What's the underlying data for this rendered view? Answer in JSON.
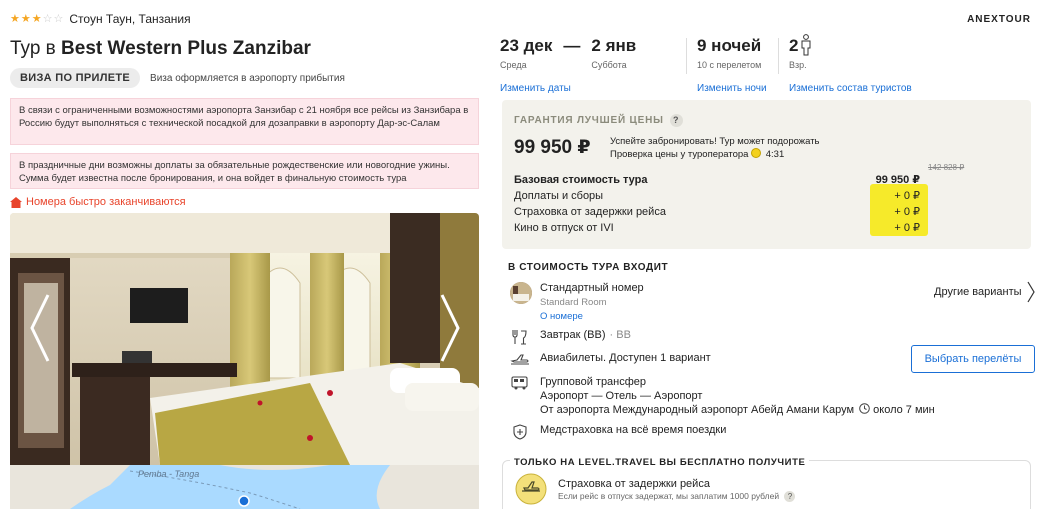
{
  "hotel": {
    "stars": 3,
    "max_stars": 5,
    "location": "Стоун Таун, Танзания",
    "title_prefix": "Тур в",
    "title_name": "Best Western Plus Zanzibar"
  },
  "visa": {
    "badge": "ВИЗА ПО ПРИЛЕТЕ",
    "note": "Виза оформляется в аэропорту прибытия"
  },
  "notices": [
    "В связи с ограниченными возможностями аэропорта Занзибар с 21 ноября все рейсы из Занзибара в Россию будут выполняться с технической посадкой для дозаправки в аэропорту Дар-эс-Салам",
    "В праздничные дни возможны доплаты за обязательные рождественские или новогодние ужины. Сумма будет известна после бронирования, и она войдет в финальную стоимость тура"
  ],
  "rooms_warning": "Номера быстро заканчиваются",
  "operator": "ANEXTOUR",
  "dates": {
    "from": "23 дек",
    "from_day": "Среда",
    "to": "2 янв",
    "to_day": "Суббота",
    "nights": "9 ночей",
    "nights_note": "10 с перелетом",
    "tourists": "2",
    "tourists_note": "Взр.",
    "change_dates": "Изменить даты",
    "change_nights": "Изменить ночи",
    "change_tourists": "Изменить состав туристов"
  },
  "price": {
    "guarantee": "ГАРАНТИЯ ЛУЧШЕЙ ЦЕНЫ",
    "question": "?",
    "main": "99 950 ₽",
    "hurry_line1": "Успейте забронировать! Тур может подорожать",
    "hurry_line2": "Проверка цены у туроператора",
    "timer": "4:31",
    "old_price": "142 828 ₽",
    "rows": [
      {
        "label": "Базовая стоимость тура",
        "value": "99 950 ₽"
      },
      {
        "label": "Доплаты и сборы",
        "value": "+ 0 ₽"
      },
      {
        "label": "Страховка от задержки рейса",
        "value": "+ 0 ₽"
      },
      {
        "label": "Кино в отпуск от IVI",
        "value": "+ 0 ₽"
      }
    ]
  },
  "includes": {
    "title": "В СТОИМОСТЬ ТУРА ВХОДИТ",
    "room": "Стандартный номер",
    "room_type": "Standard Room",
    "room_link": "О номере",
    "other_variants": "Другие варианты",
    "meal": "Завтрак (BB)",
    "meal_code": "· BB",
    "flights": "Авиабилеты. Доступен 1 вариант",
    "flight_button": "Выбрать перелёты",
    "transfer": "Групповой трансфер",
    "transfer_route": "Аэропорт — Отель — Аэропорт",
    "transfer_from": "От аэропорта Международный аэропорт Абейд Амани Карум",
    "transfer_time": "около 7 мин",
    "insurance": "Медстраховка на всё время поездки"
  },
  "free": {
    "title": "ТОЛЬКО НА LEVEL.TRAVEL ВЫ БЕСПЛАТНО ПОЛУЧИТЕ",
    "item_title": "Страховка от задержки рейса",
    "item_sub": "Если рейс в отпуск задержат, мы заплатим 1000 рублей"
  },
  "map": {
    "label": "Pemba - Tanga"
  },
  "colors": {
    "link": "#1a6fd6",
    "warning": "#e8442b",
    "notice_bg": "#fde8ec",
    "price_box_bg": "#f3f2ec",
    "highlight": "#f6ea2a",
    "star": "#f5a623"
  }
}
